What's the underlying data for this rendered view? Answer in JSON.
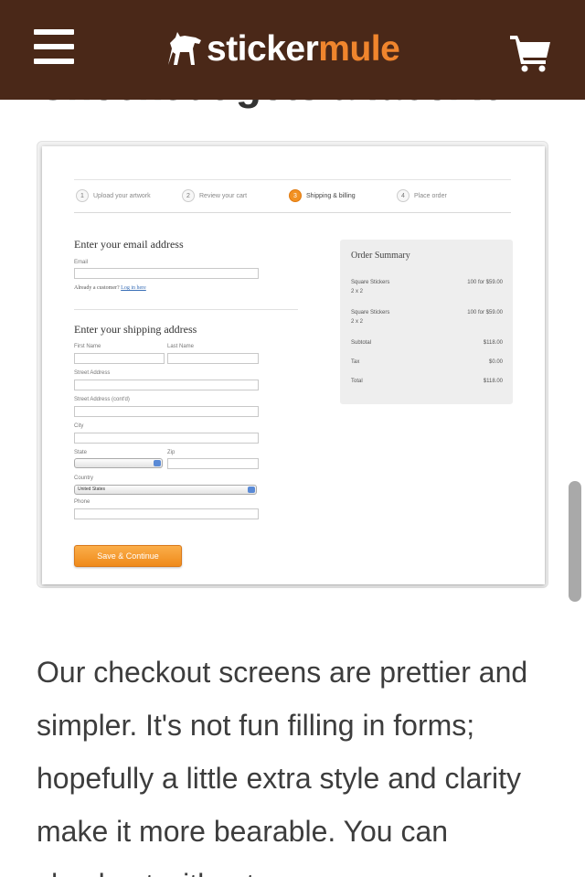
{
  "header": {
    "logo_left": "sticker",
    "logo_right": "mule",
    "menu_icon": "hamburger-menu-icon",
    "cart_icon": "shopping-cart-icon",
    "bg_color": "#4a2818",
    "accent_color": "#f0852d"
  },
  "article": {
    "heading_partial": "Checkout gets a facelift",
    "body": "Our checkout screens are prettier and simpler. It's not fun filling in forms; hopefully a little extra style and clarity make it more bearable. You can checkout without"
  },
  "screenshot": {
    "steps": [
      {
        "num": "1",
        "label": "Upload your artwork"
      },
      {
        "num": "2",
        "label": "Review your cart"
      },
      {
        "num": "3",
        "label": "Shipping & billing"
      },
      {
        "num": "4",
        "label": "Place order"
      }
    ],
    "email_section": {
      "title": "Enter your email address",
      "email_label": "Email",
      "customer_text": "Already a customer?",
      "login_link": "Log in here"
    },
    "shipping_section": {
      "title": "Enter your shipping address",
      "first_name": "First Name",
      "last_name": "Last Name",
      "street": "Street Address",
      "street2": "Street Address (cont'd)",
      "city": "City",
      "state": "State",
      "zip": "Zip",
      "country": "Country",
      "country_value": "United States",
      "phone": "Phone"
    },
    "cta": "Save & Continue",
    "summary": {
      "title": "Order Summary",
      "items": [
        {
          "label": "Square Stickers\n2 x 2",
          "value": "100 for $59.00"
        },
        {
          "label": "Square Stickers\n2 x 2",
          "value": "100 for $59.00"
        }
      ],
      "subtotal_label": "Subtotal",
      "subtotal": "$118.00",
      "tax_label": "Tax",
      "tax": "$0.00",
      "total_label": "Total",
      "total": "$118.00"
    }
  }
}
